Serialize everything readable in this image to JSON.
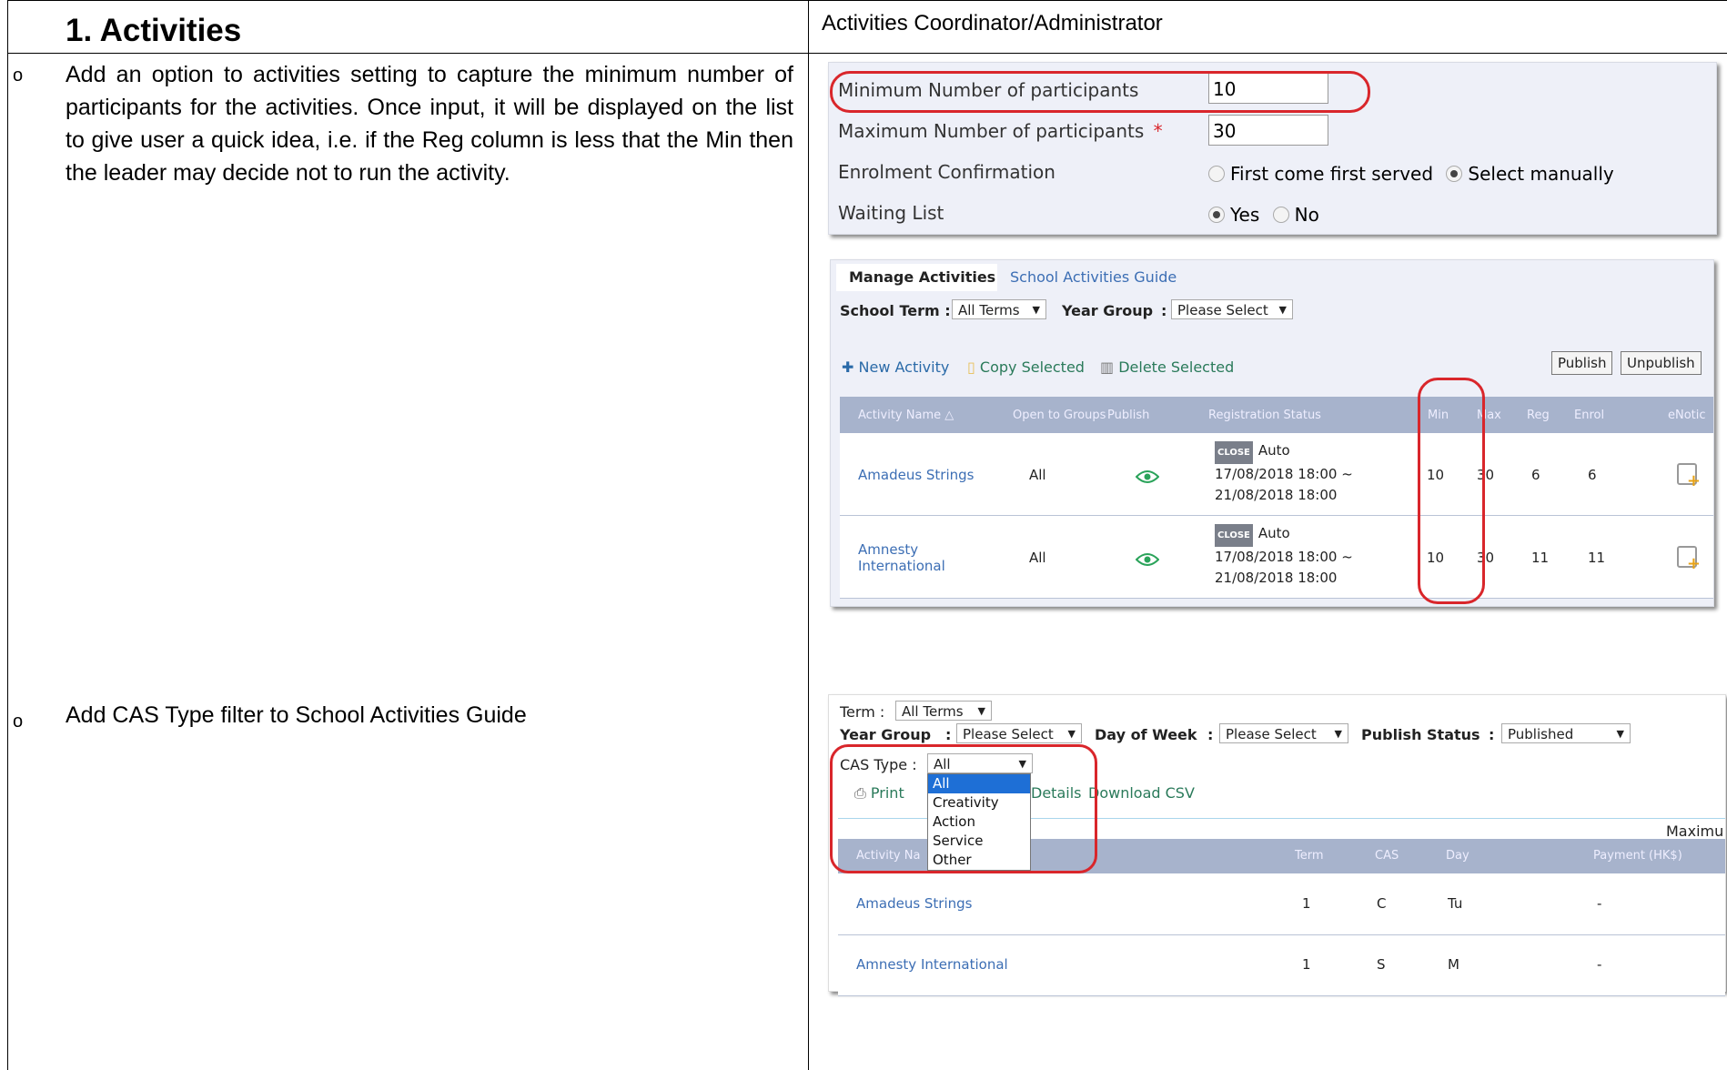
{
  "left": {
    "heading": "1.  Activities",
    "bullet_glyph": "o",
    "bullet1": "Add an option to activities setting to capture the minimum number of participants for the activities. Once input, it will be displayed on the list to give user a quick idea, i.e. if the Reg column is less that the Min then the leader may decide not to run the activity.",
    "bullet2": "Add CAS Type filter to School Activities Guide"
  },
  "right": {
    "heading": "Activities Coordinator/Administrator"
  },
  "settings": {
    "min_label": "Minimum Number of participants",
    "min_value": "10",
    "max_label": "Maximum Number of participants",
    "required_mark": "*",
    "max_value": "30",
    "enrol_label": "Enrolment Confirmation",
    "enrol_opt1": "First come first served",
    "enrol_opt2": "Select manually",
    "enrol_selected": "Select manually",
    "wait_label": "Waiting List",
    "wait_yes": "Yes",
    "wait_no": "No",
    "wait_selected": "Yes"
  },
  "manage": {
    "tab_active": "Manage Activities",
    "tab_other": "School Activities Guide",
    "term_label": "School Term :",
    "term_value": "All Terms",
    "year_label": "Year Group",
    "year_colon": ":",
    "year_value": "Please Select",
    "new_activity": "New Activity",
    "copy_selected": "Copy Selected",
    "delete_selected": "Delete Selected",
    "publish_btn": "Publish",
    "unpublish_btn": "Unpublish",
    "headers": {
      "name": "Activity Name",
      "groups": "Open to Groups",
      "publish": "Publish",
      "reg_status": "Registration Status",
      "min": "Min",
      "max": "Max",
      "reg": "Reg",
      "enrol": "Enrol",
      "enotice": "eNotic"
    },
    "rows": [
      {
        "name": "Amadeus Strings",
        "groups": "All",
        "badge": "CLOSE",
        "mode": "Auto",
        "from": "17/08/2018 18:00 ~",
        "to": "21/08/2018 18:00",
        "min": "10",
        "max": "30",
        "reg": "6",
        "enrol": "6"
      },
      {
        "name": "Amnesty International",
        "name_l1": "Amnesty",
        "name_l2": "International",
        "groups": "All",
        "badge": "CLOSE",
        "mode": "Auto",
        "from": "17/08/2018 18:00 ~",
        "to": "21/08/2018 18:00",
        "min": "10",
        "max": "30",
        "reg": "11",
        "enrol": "11"
      }
    ]
  },
  "guide": {
    "term_label": "Term :",
    "term_value": "All Terms",
    "year_label": "Year Group",
    "colon": ":",
    "year_value": "Please Select",
    "day_label": "Day of Week",
    "day_value": "Please Select",
    "pub_label": "Publish Status",
    "pub_value": "Published",
    "cas_label": "CAS Type :",
    "cas_value": "All",
    "cas_options": [
      "All",
      "Creativity",
      "Action",
      "Service",
      "Other"
    ],
    "print_text": "Print",
    "details_text": "Details",
    "csv_text": "Download CSV",
    "maximum_text": "Maximu",
    "headers": {
      "name": "Activity Na",
      "term": "Term",
      "cas": "CAS",
      "day": "Day",
      "payment": "Payment (HK$)"
    },
    "rows": [
      {
        "name": "Amadeus Strings",
        "term": "1",
        "cas": "C",
        "day": "Tu",
        "payment": "-"
      },
      {
        "name": "Amnesty International",
        "term": "1",
        "cas": "S",
        "day": "M",
        "payment": "-"
      }
    ]
  },
  "colors": {
    "accent_red": "#d9262b",
    "link_blue": "#3c6eb4",
    "header_bar": "#a7b3cc",
    "panel_bg": "#eef0f8"
  },
  "icons": [
    "eye-icon",
    "note-add-icon",
    "plus-icon",
    "copy-icon",
    "trash-icon",
    "printer-icon",
    "dropdown-arrow-icon"
  ]
}
